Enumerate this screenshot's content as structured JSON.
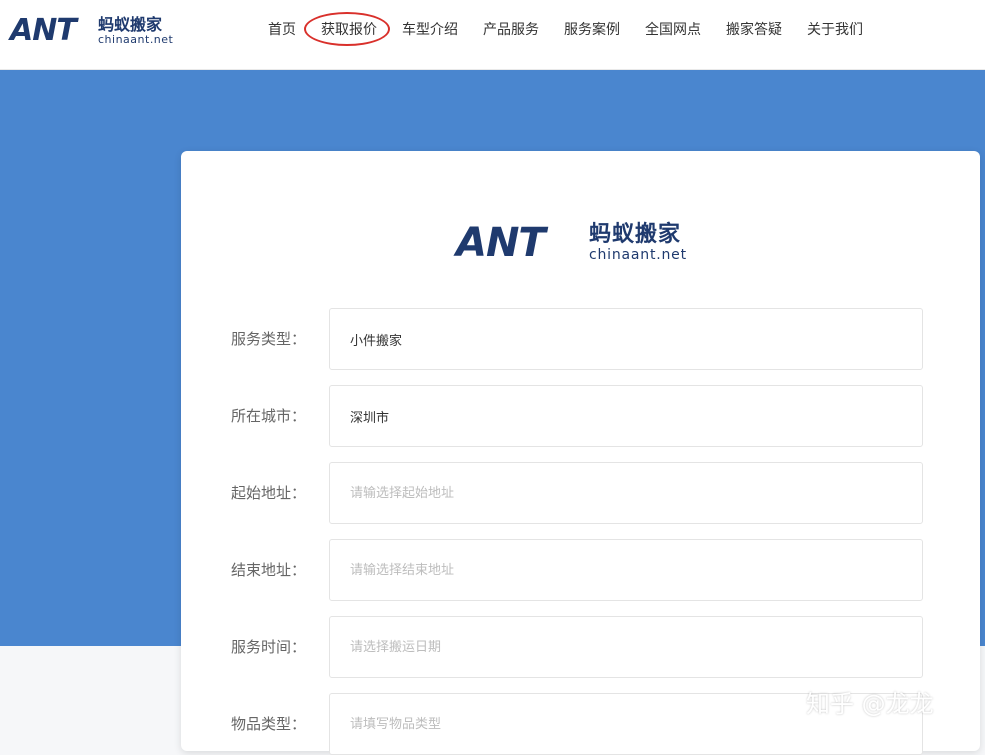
{
  "header": {
    "logo": {
      "brand": "ANT",
      "cn": "蚂蚁搬家",
      "en": "chinaant.net"
    },
    "nav": [
      {
        "label": "首页"
      },
      {
        "label": "获取报价"
      },
      {
        "label": "车型介绍"
      },
      {
        "label": "产品服务"
      },
      {
        "label": "服务案例"
      },
      {
        "label": "全国网点"
      },
      {
        "label": "搬家答疑"
      },
      {
        "label": "关于我们"
      }
    ]
  },
  "card": {
    "logo": {
      "brand": "ANT",
      "cn": "蚂蚁搬家",
      "en": "chinaant.net"
    },
    "form": [
      {
        "label": "服务类型：",
        "value": "小件搬家",
        "placeholder": ""
      },
      {
        "label": "所在城市：",
        "value": "深圳市",
        "placeholder": ""
      },
      {
        "label": "起始地址：",
        "value": "",
        "placeholder": "请输选择起始地址"
      },
      {
        "label": "结束地址：",
        "value": "",
        "placeholder": "请输选择结束地址"
      },
      {
        "label": "服务时间：",
        "value": "",
        "placeholder": "请选择搬运日期"
      },
      {
        "label": "物品类型：",
        "value": "",
        "placeholder": "请填写物品类型"
      }
    ]
  },
  "watermark": "知乎 @龙龙",
  "colors": {
    "brand": "#1f3a6e",
    "band": "#4a86cf",
    "highlight": "#d9302b"
  }
}
